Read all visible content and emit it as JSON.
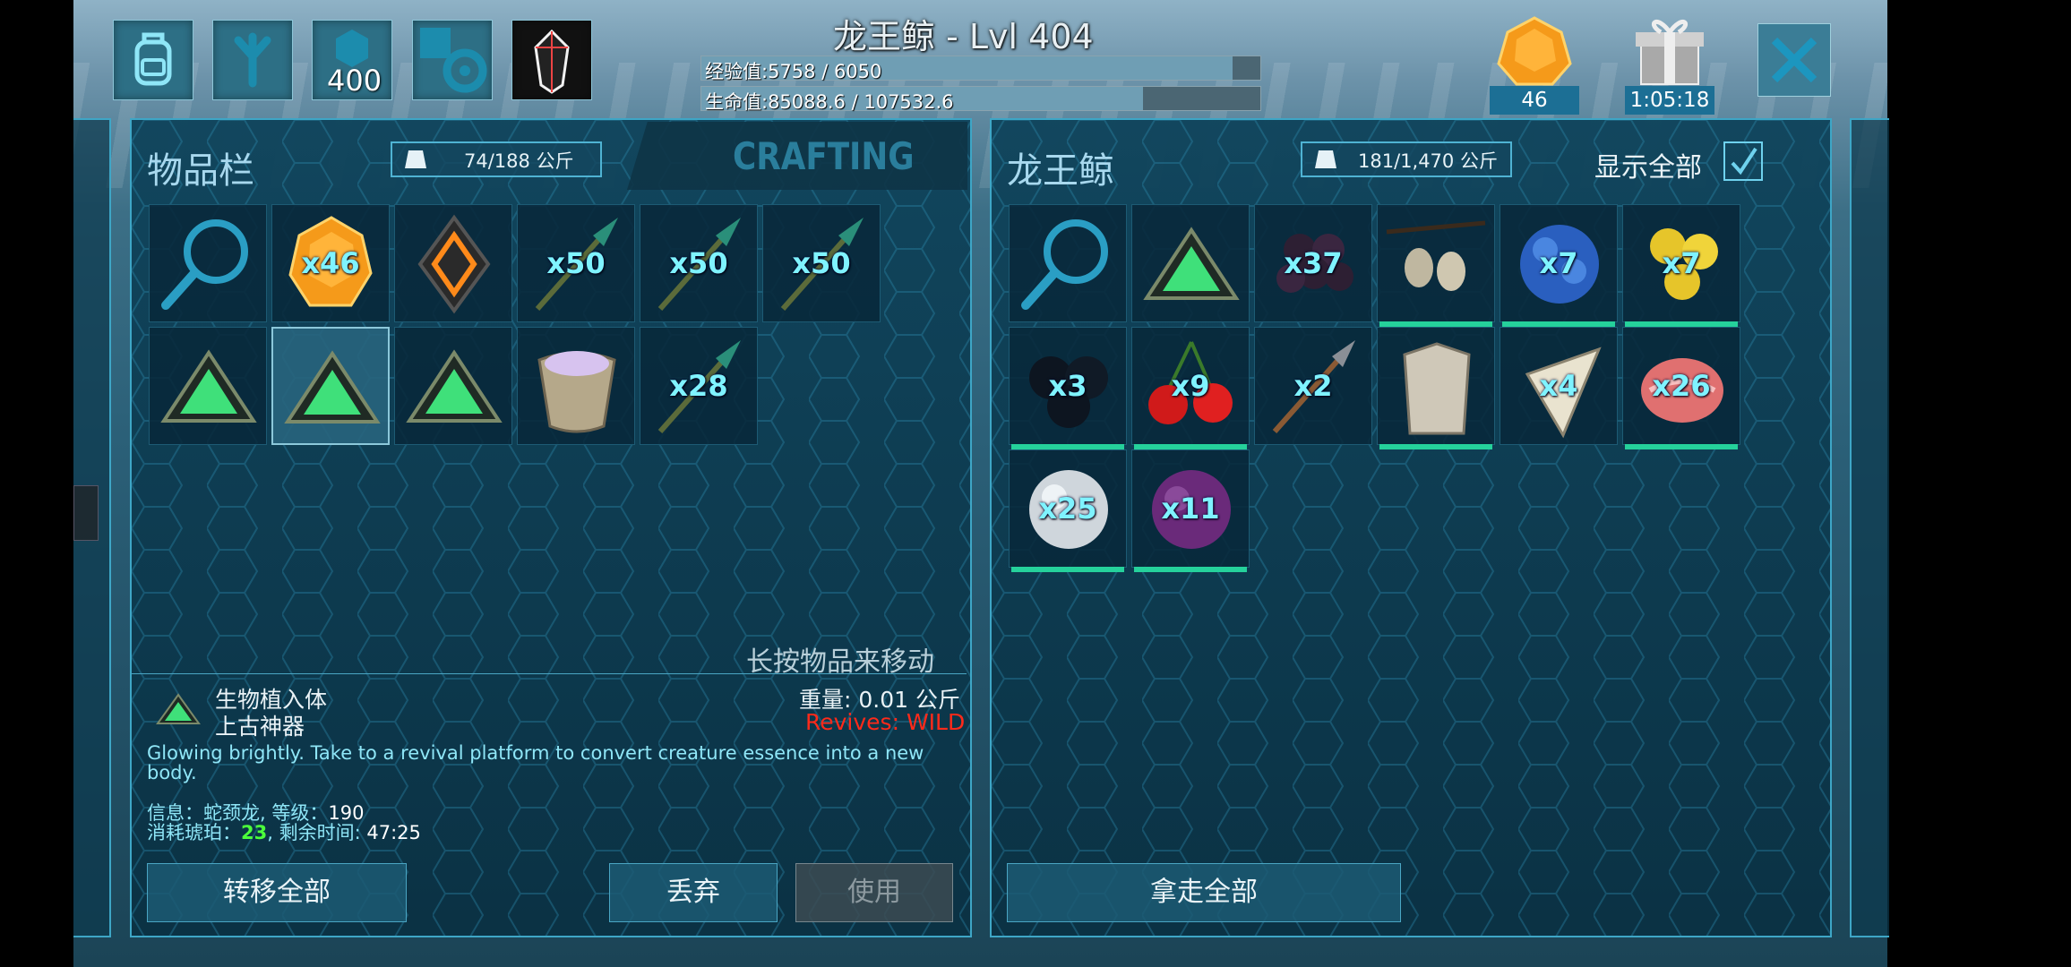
{
  "header": {
    "title": "龙王鲸 - Lvl 404",
    "top_icons": [
      {
        "name": "backpack-icon"
      },
      {
        "name": "footprint-icon"
      },
      {
        "name": "engram-points-icon",
        "badge": "400"
      },
      {
        "name": "settings-gear-icon"
      },
      {
        "name": "tek-crystal-icon"
      }
    ],
    "xp_label": "经验值:5758 / 6050",
    "xp_progress": 0.95,
    "health_label": "生命值:85088.6 / 107532.6",
    "health_progress": 0.79,
    "amber_count": "46",
    "gift_timer": "1:05:18",
    "close_icon": "close-icon"
  },
  "left_panel": {
    "title": "物品栏",
    "weight": "74/188 公斤",
    "crafting_tab": "CRAFTING",
    "hint": "长按物品来移动",
    "slots": [
      {
        "icon": "search-icon",
        "qty": ""
      },
      {
        "icon": "amber-icon",
        "qty": "x46"
      },
      {
        "icon": "implant-amulet-icon",
        "qty": ""
      },
      {
        "icon": "spear-arrow-icon",
        "qty": "x50"
      },
      {
        "icon": "spear-arrow-icon",
        "qty": "x50"
      },
      {
        "icon": "spear-arrow-icon",
        "qty": "x50"
      },
      {
        "icon": "cryopod-implant-icon",
        "qty": ""
      },
      {
        "icon": "cryopod-implant-icon",
        "qty": ""
      },
      {
        "icon": "cryopod-implant-icon",
        "qty": ""
      },
      {
        "icon": "mortar-bowl-icon",
        "qty": ""
      },
      {
        "icon": "spear-arrow-icon",
        "qty": "x28"
      }
    ],
    "selected_index": 7,
    "info": {
      "name1": "生物植入体",
      "name2": "上古神器",
      "weight": "重量: 0.01 公斤",
      "revives": "Revives: WILD",
      "desc": "Glowing brightly. Take to a revival platform to convert creature essence into a new body.",
      "info_line_prefix": "信息：蛇颈龙, 等级：",
      "info_level": "190",
      "cost_prefix": "消耗琥珀：",
      "cost_value": "23",
      "cost_sep": ", 剩余时间: ",
      "cost_time": "47:25"
    },
    "buttons": {
      "transfer_all": "转移全部",
      "drop": "丢弃",
      "use": "使用"
    }
  },
  "right_panel": {
    "title": "龙王鲸",
    "weight": "181/1,470 公斤",
    "show_all_label": "显示全部",
    "show_all_checked": true,
    "slots": [
      {
        "icon": "search-icon",
        "qty": "",
        "dur": false
      },
      {
        "icon": "cryopod-implant-icon",
        "qty": "",
        "dur": false
      },
      {
        "icon": "narcoberry-icon",
        "qty": "x37",
        "dur": false
      },
      {
        "icon": "seed-branch-icon",
        "qty": "",
        "dur": true
      },
      {
        "icon": "azulberry-icon",
        "qty": "x7",
        "dur": true
      },
      {
        "icon": "amarberry-icon",
        "qty": "x7",
        "dur": true
      },
      {
        "icon": "mejoberry-icon",
        "qty": "x3",
        "dur": true
      },
      {
        "icon": "tintoberry-icon",
        "qty": "x9",
        "dur": true
      },
      {
        "icon": "spear-icon",
        "qty": "x2",
        "dur": false
      },
      {
        "icon": "cloth-shirt-icon",
        "qty": "",
        "dur": true
      },
      {
        "icon": "shark-tooth-icon",
        "qty": "x4",
        "dur": false
      },
      {
        "icon": "raw-meat-icon",
        "qty": "x26",
        "dur": true
      },
      {
        "icon": "silica-pearl-icon",
        "qty": "x25",
        "dur": true
      },
      {
        "icon": "black-pearl-icon",
        "qty": "x11",
        "dur": true
      }
    ],
    "buttons": {
      "take_all": "拿走全部"
    }
  },
  "colors": {
    "accent": "#3ea6c6",
    "qty": "#7ff3ff",
    "revive_red": "#ff2a1a",
    "cost_green": "#4cff3b",
    "durability": "#25d19b"
  }
}
